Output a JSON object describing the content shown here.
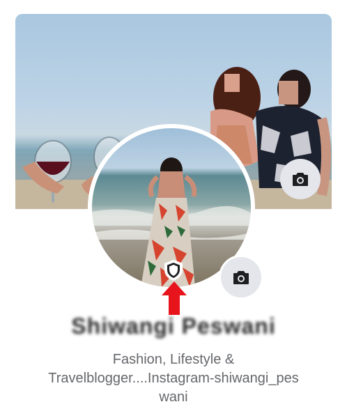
{
  "profile": {
    "name": "Shiwangi Peswani",
    "bio_lines": [
      "Fashion, Lifestyle &",
      "Travelblogger....Instagram-shiwangi_pes",
      "wani"
    ]
  },
  "icons": {
    "cover_camera": "camera-icon",
    "profile_camera": "camera-icon",
    "profile_guard": "shield-icon",
    "annotation_arrow": "arrow-up-icon"
  },
  "colors": {
    "camera_button_bg": "#e4e6eb",
    "arrow": "#e8141b",
    "bio_text": "#65676b"
  }
}
